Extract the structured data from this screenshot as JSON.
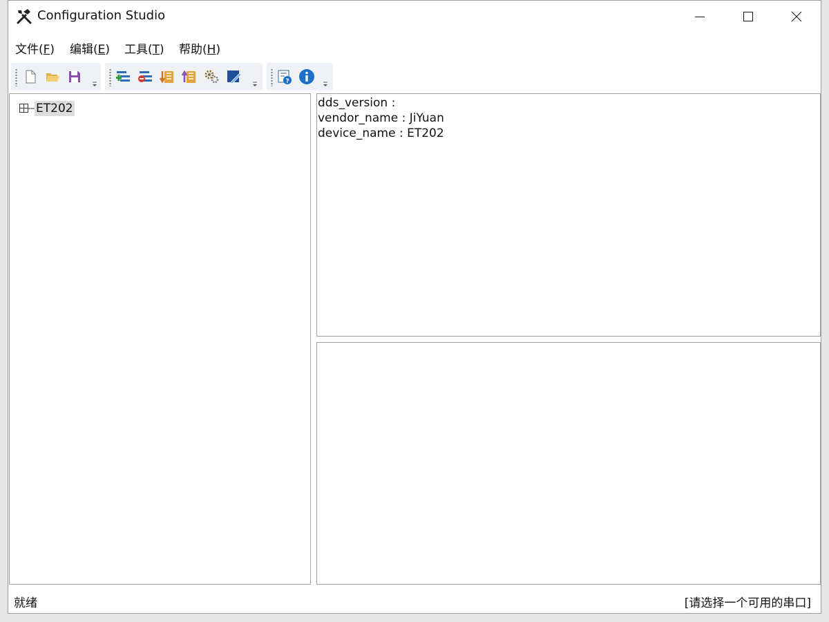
{
  "window": {
    "title": "Configuration Studio"
  },
  "menu": [
    {
      "label": "文件(",
      "key": "F",
      "end": ")"
    },
    {
      "label": "编辑(",
      "key": "E",
      "end": ")"
    },
    {
      "label": "工具(",
      "key": "T",
      "end": ")"
    },
    {
      "label": "帮助(",
      "key": "H",
      "end": ")"
    }
  ],
  "toolbar": {
    "file_group": [
      "new-file-icon",
      "open-folder-icon",
      "save-icon"
    ],
    "edit_group": [
      "add-node-icon",
      "remove-node-icon",
      "import-icon",
      "export-icon",
      "settings-icon",
      "edit-icon"
    ],
    "help_group": [
      "help-icon",
      "info-icon"
    ]
  },
  "tree": {
    "root_label": "ET202",
    "expanded": false
  },
  "info": {
    "lines": [
      "dds_version :",
      "vendor_name : JiYuan",
      "device_name : ET202"
    ]
  },
  "status": {
    "left": "就绪",
    "right": "[请选择一个可用的串口]"
  },
  "colors": {
    "toolbar_bg": "#eef1f5",
    "selection_bg": "#dcdcdc",
    "info_blue": "#1c6fc9"
  }
}
